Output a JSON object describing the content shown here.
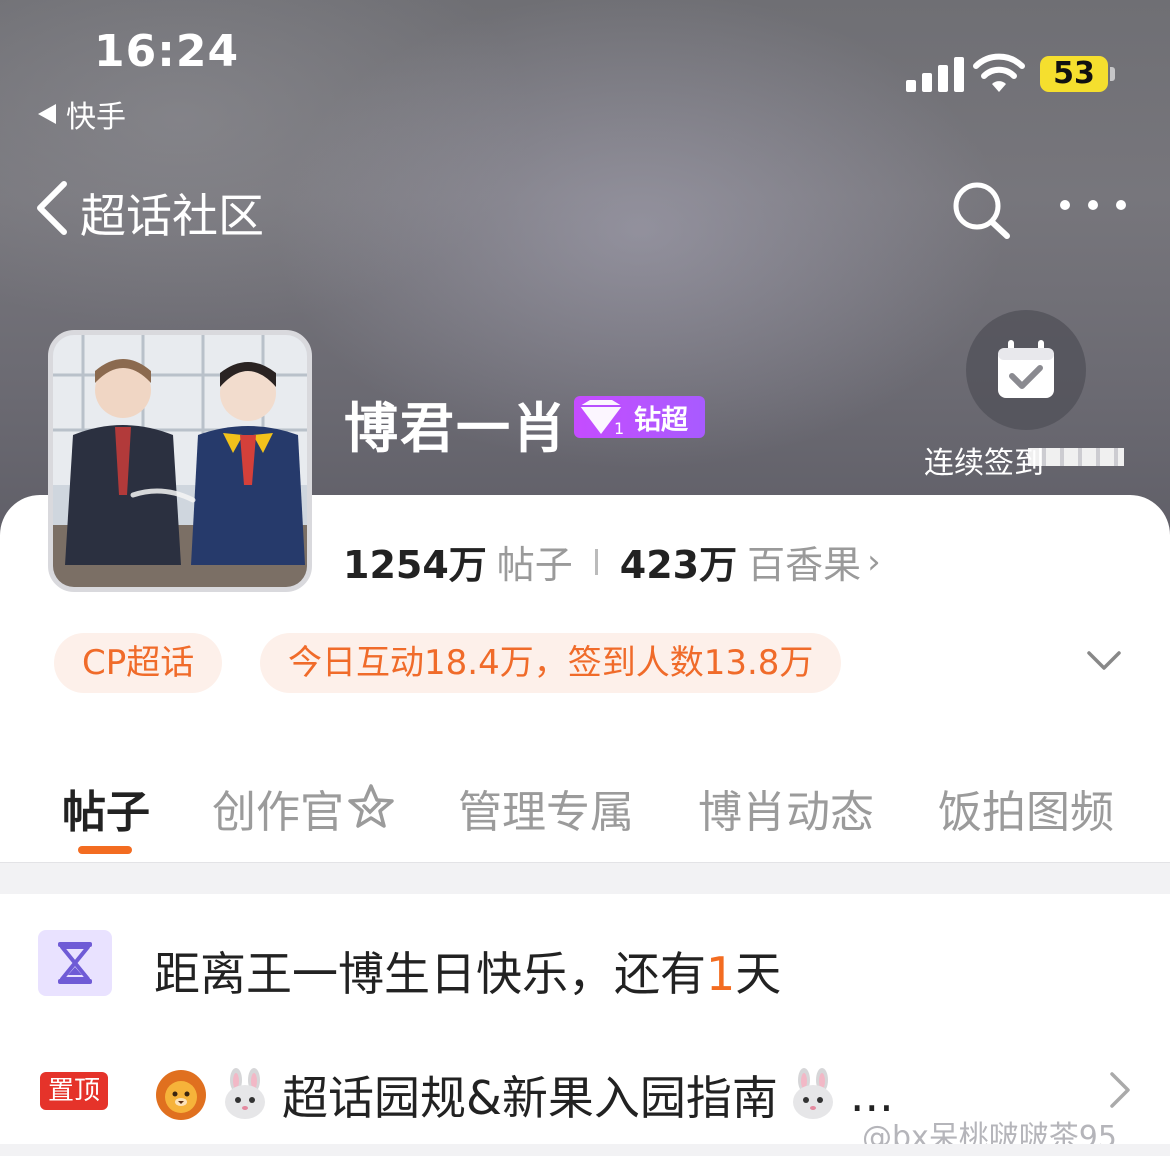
{
  "status_bar": {
    "time": "16:24",
    "back_app": "快手",
    "battery": "53"
  },
  "nav": {
    "title": "超话社区",
    "search_icon": "search-icon",
    "more_icon": "more-icon"
  },
  "community": {
    "name": "博君一肖",
    "rank_label": "钻超",
    "rank_level": "1",
    "checkin_label": "连续签到"
  },
  "stats": {
    "posts_count": "1254万",
    "posts_label": "帖子",
    "fans_count": "423万",
    "fans_label": "百香果"
  },
  "tags": {
    "category": "CP超话",
    "activity": "今日互动18.4万，签到人数13.8万"
  },
  "tabs": [
    {
      "label": "帖子",
      "active": true
    },
    {
      "label": "创作官"
    },
    {
      "label": "管理专属"
    },
    {
      "label": "博肖动态"
    },
    {
      "label": "饭拍图频"
    }
  ],
  "countdown": {
    "prefix": "距离王一博生日快乐，还有",
    "days": "1",
    "suffix": "天"
  },
  "pinned": {
    "badge": "置顶",
    "title": "超话园规&新果入园指南",
    "ellipsis": "..."
  },
  "watermark": "@bx呆桃啵啵茶95",
  "colors": {
    "accent": "#f36c21",
    "tag_bg": "#fdf0ea",
    "rank_badge": "#b84fff",
    "pin_badge": "#e5332a"
  }
}
